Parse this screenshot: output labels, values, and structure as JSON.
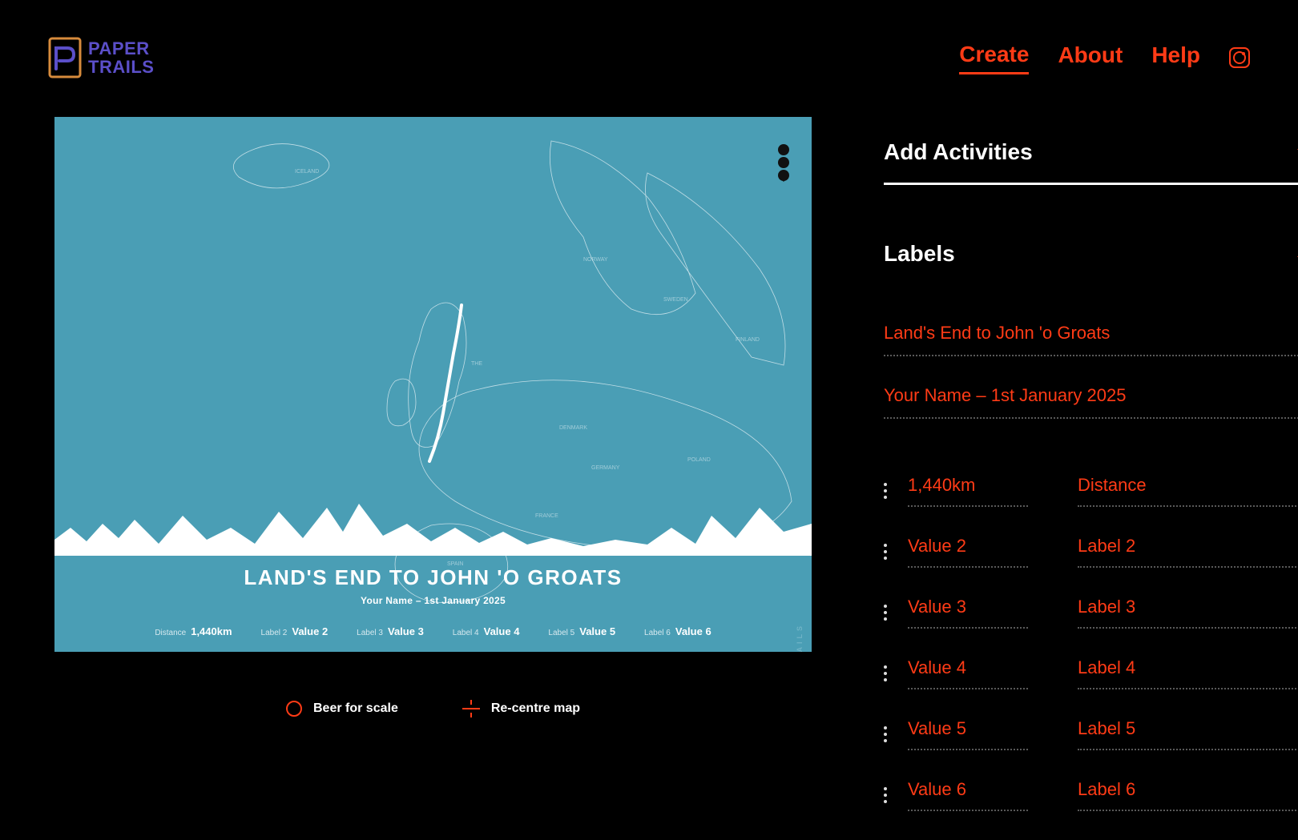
{
  "brand": {
    "line1": "PAPER",
    "line2": "TRAILS"
  },
  "nav": {
    "create": "Create",
    "about": "About",
    "help": "Help"
  },
  "map": {
    "title": "LAND'S END TO JOHN 'O GROATS",
    "subtitle": "Your Name – 1st January 2025",
    "watermark": "PAPERTRAILS",
    "stats": [
      {
        "label": "Distance",
        "value": "1,440km"
      },
      {
        "label": "Label 2",
        "value": "Value 2"
      },
      {
        "label": "Label 3",
        "value": "Value 3"
      },
      {
        "label": "Label 4",
        "value": "Value 4"
      },
      {
        "label": "Label 5",
        "value": "Value 5"
      },
      {
        "label": "Label 6",
        "value": "Value 6"
      }
    ]
  },
  "legend": {
    "beer": "Beer for scale",
    "recentre": "Re-centre map"
  },
  "sidebar": {
    "add_activities": "Add Activities",
    "labels_heading": "Labels",
    "title_input": "Land's End to John 'o Groats",
    "subtitle_input": "Your Name – 1st January 2025",
    "rows": [
      {
        "value": "1,440km",
        "label": "Distance"
      },
      {
        "value": "Value 2",
        "label": "Label 2"
      },
      {
        "value": "Value 3",
        "label": "Label 3"
      },
      {
        "value": "Value 4",
        "label": "Label 4"
      },
      {
        "value": "Value 5",
        "label": "Label 5"
      },
      {
        "value": "Value 6",
        "label": "Label 6"
      }
    ]
  },
  "colors": {
    "accent": "#ff3b16",
    "map": "#4a9eb5"
  }
}
